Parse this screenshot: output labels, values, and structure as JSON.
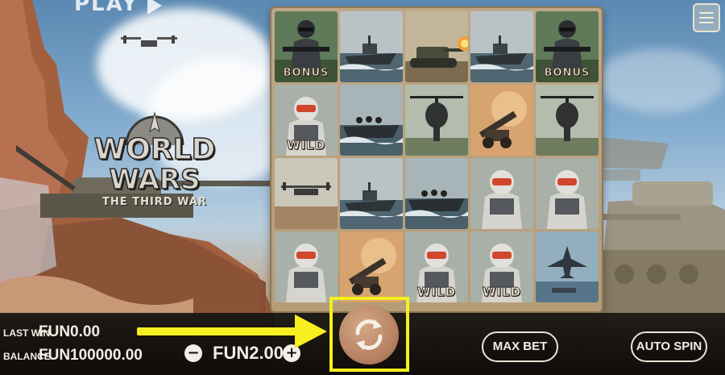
{
  "game": {
    "logo": {
      "line1": "WORLD",
      "line2": "WARS",
      "subtitle": "THE THIRD WAR"
    },
    "overlay_play_text": "PLAY"
  },
  "reels": {
    "rows": [
      [
        {
          "symbol": "soldier-rifle",
          "label": "BONUS"
        },
        {
          "symbol": "patrol-boat",
          "label": ""
        },
        {
          "symbol": "tank-firing",
          "label": ""
        },
        {
          "symbol": "patrol-boat",
          "label": ""
        },
        {
          "symbol": "soldier-rifle",
          "label": "BONUS"
        }
      ],
      [
        {
          "symbol": "armored-soldier",
          "label": "WILD"
        },
        {
          "symbol": "troop-boat",
          "label": ""
        },
        {
          "symbol": "helicopter",
          "label": ""
        },
        {
          "symbol": "artillery",
          "label": ""
        },
        {
          "symbol": "helicopter",
          "label": ""
        }
      ],
      [
        {
          "symbol": "drone",
          "label": ""
        },
        {
          "symbol": "patrol-boat",
          "label": ""
        },
        {
          "symbol": "troop-boat",
          "label": ""
        },
        {
          "symbol": "armored-soldier",
          "label": ""
        },
        {
          "symbol": "armored-soldier",
          "label": ""
        }
      ],
      [
        {
          "symbol": "armored-soldier",
          "label": ""
        },
        {
          "symbol": "artillery",
          "label": ""
        },
        {
          "symbol": "armored-soldier",
          "label": "WILD"
        },
        {
          "symbol": "armored-soldier",
          "label": "WILD"
        },
        {
          "symbol": "jet-fighter",
          "label": ""
        }
      ]
    ]
  },
  "hud": {
    "last_win_label": "LAST WIN",
    "last_win_value": "FUN0.00",
    "balance_label": "BALANCE",
    "balance_value": "FUN100000.00",
    "bet_value": "FUN2.00",
    "decrease_label": "−",
    "increase_label": "+",
    "max_bet_label": "MAX BET",
    "auto_spin_label": "AUTO SPIN"
  },
  "annotation": {
    "highlight_color": "#f7ef1e",
    "target": "spin-button"
  },
  "colors": {
    "frame": "#bda786",
    "bar": "#141210",
    "spin": "#b88464",
    "text": "#f1ece3"
  }
}
